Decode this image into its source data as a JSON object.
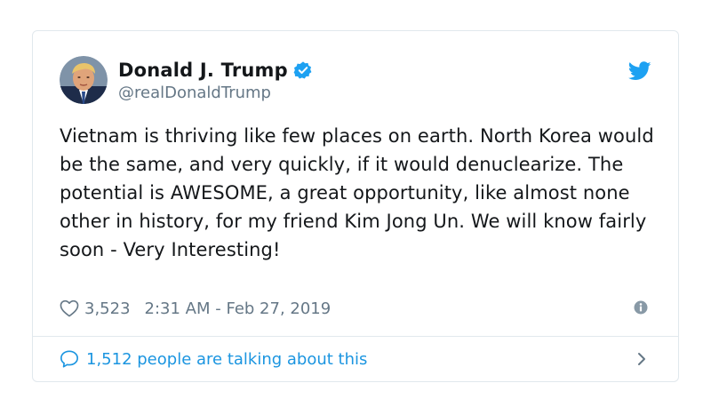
{
  "tweet": {
    "author": {
      "name": "Donald J. Trump",
      "handle": "@realDonaldTrump",
      "verified": true
    },
    "text": "Vietnam is thriving like few places on earth. North Korea would be the same, and very quickly, if it would denuclearize. The potential is AWESOME, a great opportunity, like almost none other in history, for my friend Kim Jong Un. We will know fairly soon - Very Interesting!",
    "likes": "3,523",
    "timestamp": "2:31 AM - Feb 27, 2019",
    "conversation_label": "1,512 people are talking about this"
  },
  "icons": {
    "brand": "twitter-bird-icon",
    "verified": "verified-badge-icon",
    "like": "heart-icon",
    "info": "info-icon",
    "reply": "speech-bubble-icon",
    "more": "chevron-right-icon"
  },
  "colors": {
    "text": "#14171a",
    "secondary": "#657786",
    "accent": "#1b95e0",
    "border": "#e1e8ed"
  }
}
